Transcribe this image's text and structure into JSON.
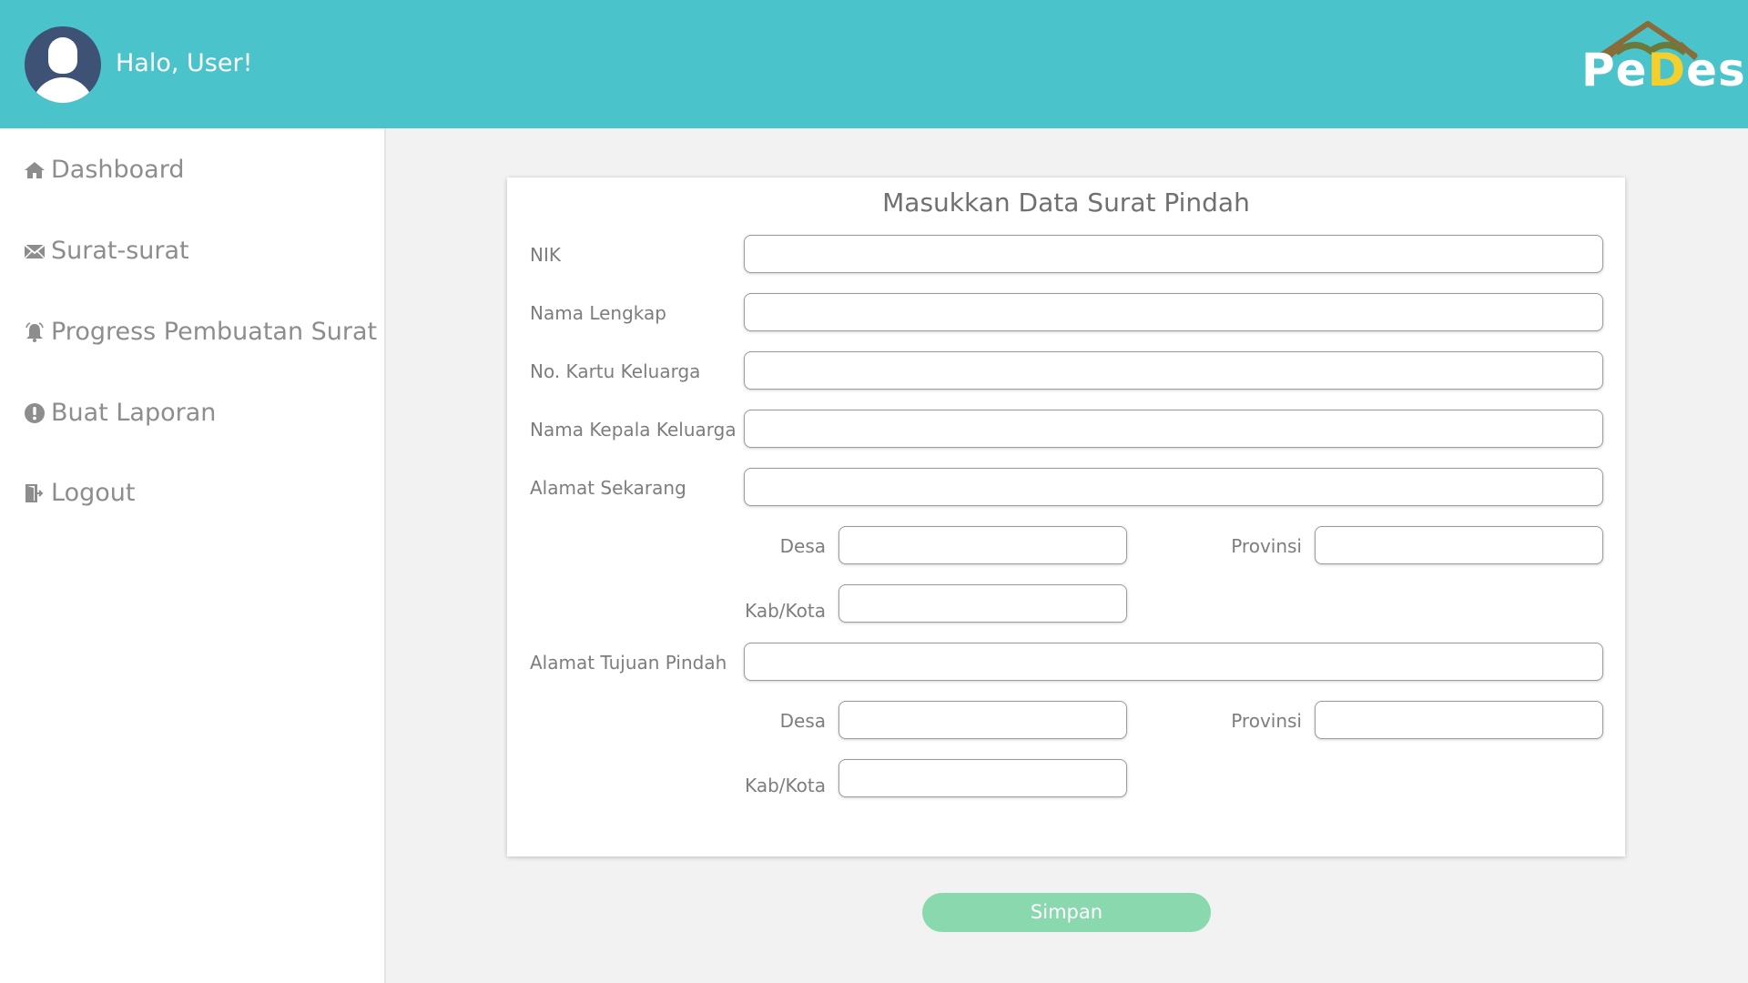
{
  "header": {
    "greeting": "Halo, User!",
    "logo": {
      "text_a": "Pe",
      "text_b": "D",
      "text_c": "es"
    }
  },
  "sidebar": {
    "items": [
      {
        "label": "Dashboard",
        "icon": "home-icon"
      },
      {
        "label": "Surat-surat",
        "icon": "envelope-icon"
      },
      {
        "label": "Progress Pembuatan Surat",
        "icon": "bell-icon"
      },
      {
        "label": "Buat Laporan",
        "icon": "exclamation-circle-icon"
      },
      {
        "label": "Logout",
        "icon": "sign-out-icon"
      }
    ]
  },
  "form": {
    "title": "Masukkan Data Surat Pindah",
    "nik": {
      "label": "NIK",
      "value": ""
    },
    "nama_lengkap": {
      "label": "Nama Lengkap",
      "value": ""
    },
    "no_kk": {
      "label": "No. Kartu Keluarga",
      "value": ""
    },
    "nama_kepala": {
      "label": "Nama Kepala Keluarga",
      "value": ""
    },
    "alamat_sekarang": {
      "label": "Alamat Sekarang",
      "value": "",
      "desa_label": "Desa",
      "provinsi_label": "Provinsi",
      "kabkota_label": "Kab/Kota"
    },
    "alamat_tujuan": {
      "label": "Alamat Tujuan Pindah",
      "value": "",
      "desa_label": "Desa",
      "provinsi_label": "Provinsi",
      "kabkota_label": "Kab/Kota"
    },
    "save_label": "Simpan"
  },
  "colors": {
    "header": "#4bc3cb",
    "save_button": "#8ad9ae",
    "logo_accent": "#f5cf2b",
    "avatar": "#3e5276"
  }
}
